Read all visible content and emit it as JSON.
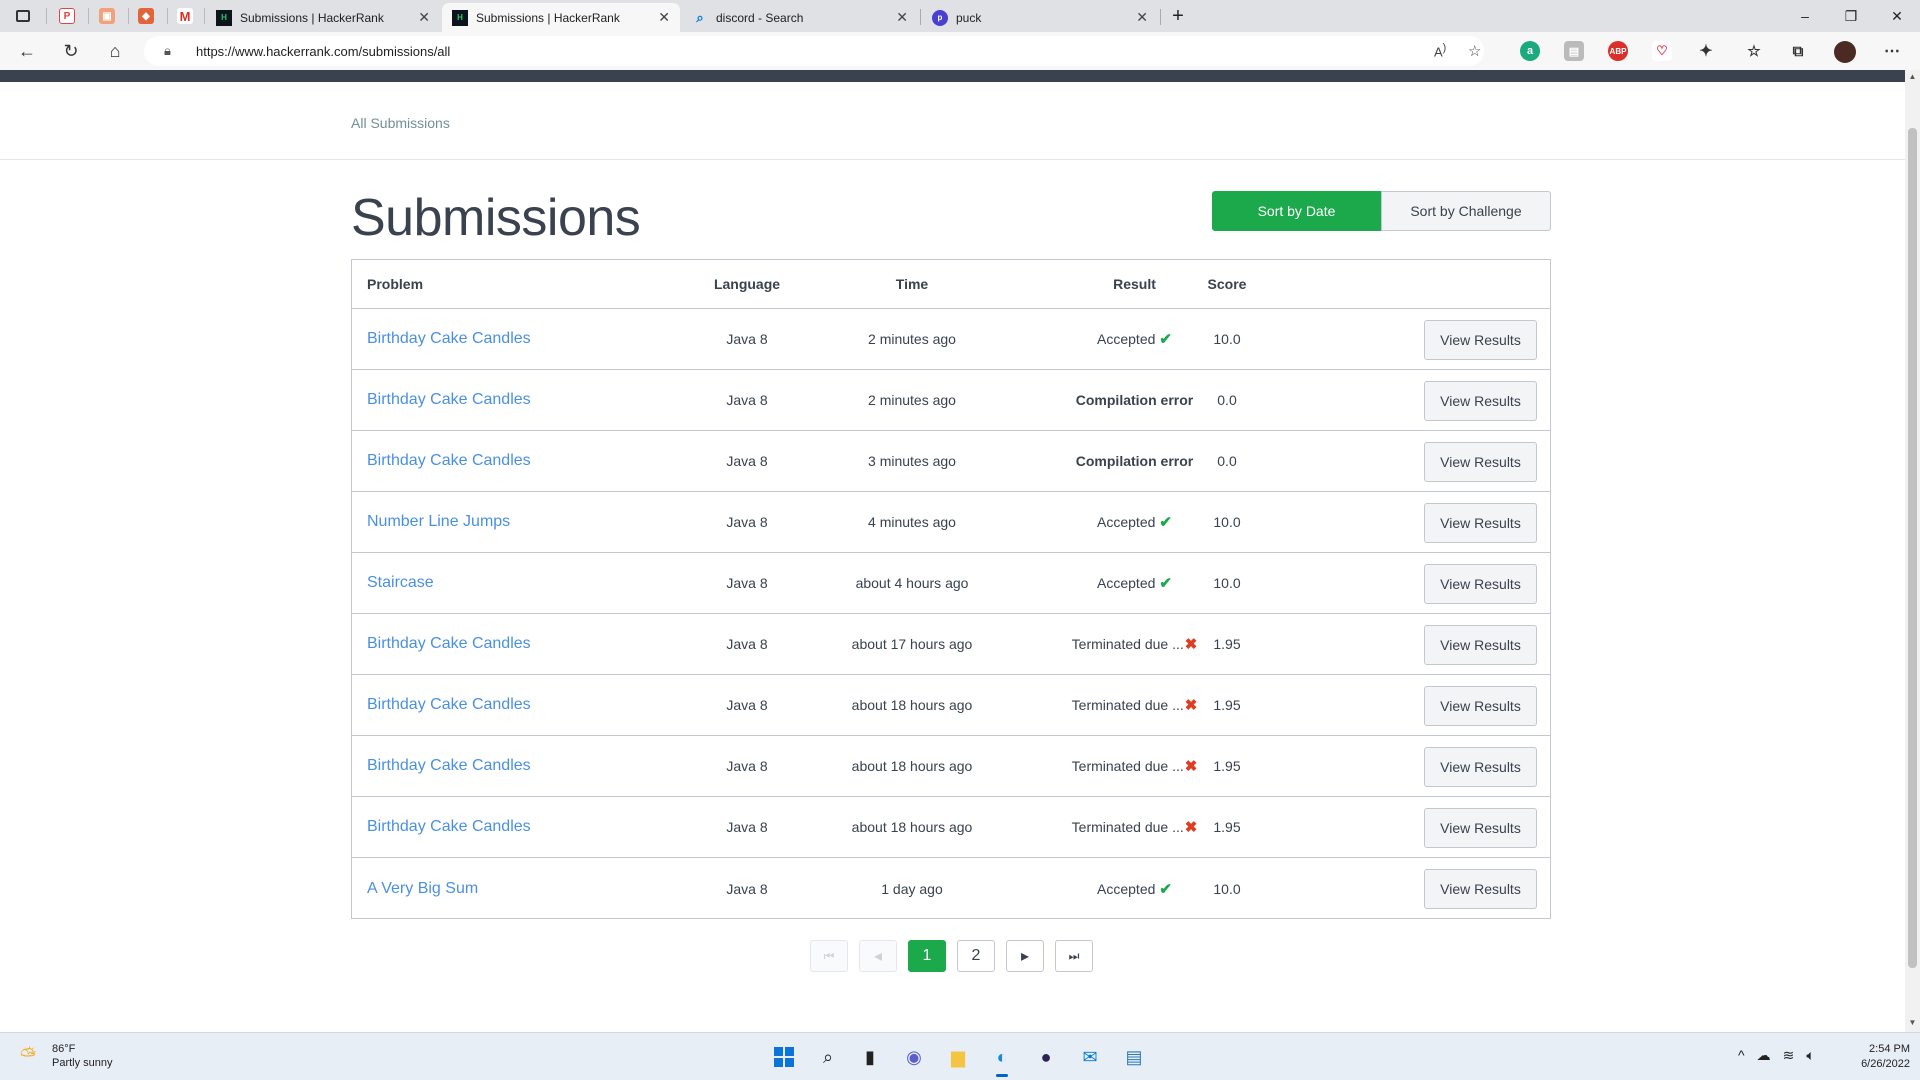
{
  "browser": {
    "tabs": [
      {
        "title": "Submissions | HackerRank",
        "active": false
      },
      {
        "title": "Submissions | HackerRank",
        "active": true
      },
      {
        "title": "discord - Search",
        "active": false
      },
      {
        "title": "puck",
        "active": false
      }
    ],
    "new_tab_label": "+",
    "url": "https://www.hackerrank.com/submissions/all",
    "window": {
      "minimize": "–",
      "restore": "❐",
      "close": "✕"
    }
  },
  "page": {
    "breadcrumb": "All Submissions",
    "title": "Submissions",
    "sort_by_date": "Sort by Date",
    "sort_by_challenge": "Sort by Challenge",
    "columns": {
      "problem": "Problem",
      "language": "Language",
      "time": "Time",
      "result": "Result",
      "score": "Score"
    },
    "view_results_label": "View Results",
    "rows": [
      {
        "problem": "Birthday Cake Candles",
        "language": "Java 8",
        "time": "2 minutes ago",
        "result": "Accepted",
        "status": "ok",
        "score": "10.0"
      },
      {
        "problem": "Birthday Cake Candles",
        "language": "Java 8",
        "time": "2 minutes ago",
        "result": "Compilation error",
        "status": "error",
        "score": "0.0"
      },
      {
        "problem": "Birthday Cake Candles",
        "language": "Java 8",
        "time": "3 minutes ago",
        "result": "Compilation error",
        "status": "error",
        "score": "0.0"
      },
      {
        "problem": "Number Line Jumps",
        "language": "Java 8",
        "time": "4 minutes ago",
        "result": "Accepted",
        "status": "ok",
        "score": "10.0"
      },
      {
        "problem": "Staircase",
        "language": "Java 8",
        "time": "about 4 hours ago",
        "result": "Accepted",
        "status": "ok",
        "score": "10.0"
      },
      {
        "problem": "Birthday Cake Candles",
        "language": "Java 8",
        "time": "about 17 hours ago",
        "result": "Terminated due ...",
        "status": "bad",
        "score": "1.95"
      },
      {
        "problem": "Birthday Cake Candles",
        "language": "Java 8",
        "time": "about 18 hours ago",
        "result": "Terminated due ...",
        "status": "bad",
        "score": "1.95"
      },
      {
        "problem": "Birthday Cake Candles",
        "language": "Java 8",
        "time": "about 18 hours ago",
        "result": "Terminated due ...",
        "status": "bad",
        "score": "1.95"
      },
      {
        "problem": "Birthday Cake Candles",
        "language": "Java 8",
        "time": "about 18 hours ago",
        "result": "Terminated due ...",
        "status": "bad",
        "score": "1.95"
      },
      {
        "problem": "A Very Big Sum",
        "language": "Java 8",
        "time": "1 day ago",
        "result": "Accepted",
        "status": "ok",
        "score": "10.0"
      }
    ],
    "pagination": {
      "first": "⏮",
      "prev": "◂",
      "pages": [
        "1",
        "2"
      ],
      "current": "1",
      "next": "▸",
      "last": "⏭"
    }
  },
  "taskbar": {
    "weather_temp": "86°F",
    "weather_desc": "Partly sunny",
    "time": "2:54 PM",
    "date": "6/26/2022"
  },
  "colors": {
    "accent_green": "#1ba94c",
    "link_blue": "#4a90e2",
    "error_red": "#e03c22",
    "header_dark": "#39424e"
  }
}
